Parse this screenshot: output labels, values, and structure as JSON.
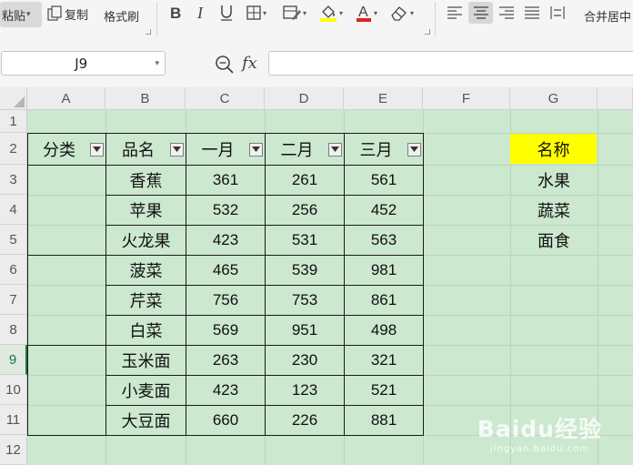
{
  "ribbon": {
    "paste_label": "粘贴",
    "copy_label": "复制",
    "format_painter_label": "格式刷",
    "merge_center_label": "合并居中"
  },
  "formula_bar": {
    "name_box": "J9",
    "fx_label": "fx",
    "formula_value": ""
  },
  "sheet": {
    "columns": [
      "A",
      "B",
      "C",
      "D",
      "E",
      "F",
      "G"
    ],
    "rows": [
      "1",
      "2",
      "3",
      "4",
      "5",
      "6",
      "7",
      "8",
      "9",
      "10",
      "11",
      "12"
    ],
    "active_row": "9",
    "table_headers": {
      "category": "分类",
      "product": "品名",
      "jan": "一月",
      "feb": "二月",
      "mar": "三月"
    },
    "table_rows": [
      {
        "product": "香蕉",
        "jan": "361",
        "feb": "261",
        "mar": "561"
      },
      {
        "product": "苹果",
        "jan": "532",
        "feb": "256",
        "mar": "452"
      },
      {
        "product": "火龙果",
        "jan": "423",
        "feb": "531",
        "mar": "563"
      },
      {
        "product": "菠菜",
        "jan": "465",
        "feb": "539",
        "mar": "981"
      },
      {
        "product": "芹菜",
        "jan": "756",
        "feb": "753",
        "mar": "861"
      },
      {
        "product": "白菜",
        "jan": "569",
        "feb": "951",
        "mar": "498"
      },
      {
        "product": "玉米面",
        "jan": "263",
        "feb": "230",
        "mar": "321"
      },
      {
        "product": "小麦面",
        "jan": "423",
        "feb": "123",
        "mar": "521"
      },
      {
        "product": "大豆面",
        "jan": "660",
        "feb": "226",
        "mar": "881"
      }
    ],
    "name_list": {
      "header": "名称",
      "items": [
        "水果",
        "蔬菜",
        "面食"
      ]
    }
  },
  "watermark": {
    "logo": "Baidu经验",
    "sub": "jingyan.baidu.com"
  },
  "colors": {
    "cell_bg": "#cce8cf",
    "highlight": "#ffff00",
    "active_accent": "#217346"
  }
}
